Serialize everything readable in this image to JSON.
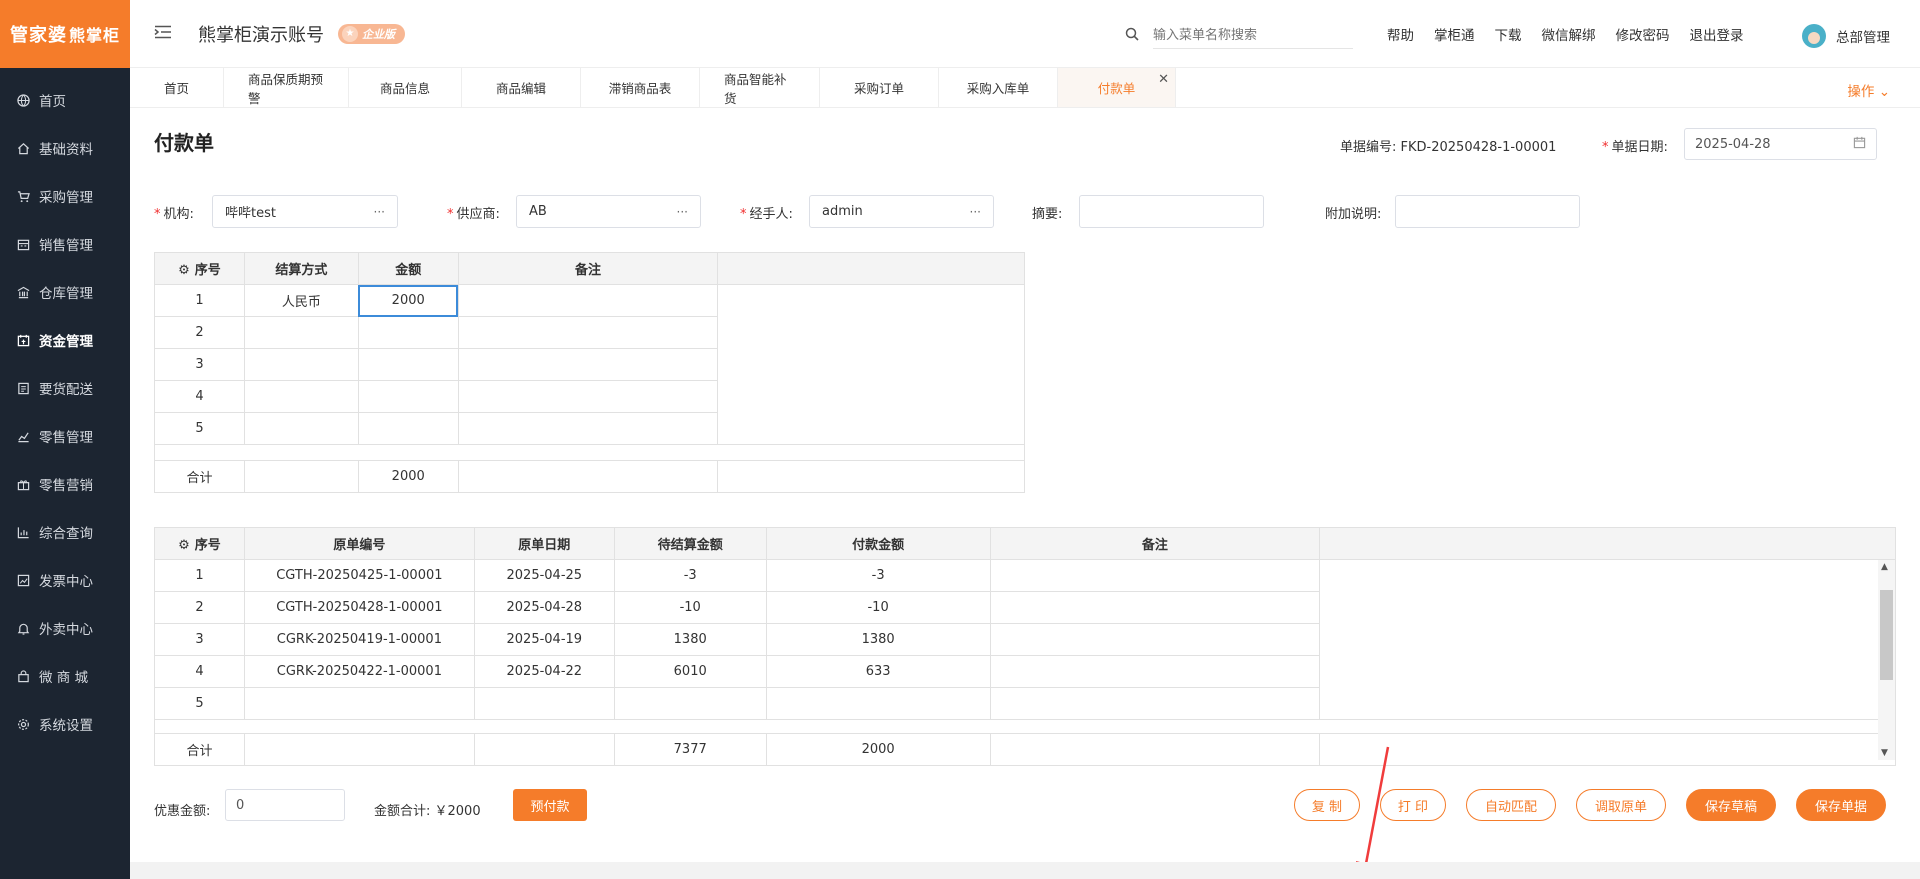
{
  "logo": {
    "main": "管家婆",
    "sub": "熊掌柜"
  },
  "sidebar": {
    "items": [
      {
        "label": "首页",
        "icon": "globe-icon"
      },
      {
        "label": "基础资料",
        "icon": "home-icon"
      },
      {
        "label": "采购管理",
        "icon": "cart-icon"
      },
      {
        "label": "销售管理",
        "icon": "calendar-icon"
      },
      {
        "label": "仓库管理",
        "icon": "bank-icon"
      },
      {
        "label": "资金管理",
        "icon": "calendar-check-icon"
      },
      {
        "label": "要货配送",
        "icon": "list-icon"
      },
      {
        "label": "零售管理",
        "icon": "chart-icon"
      },
      {
        "label": "零售营销",
        "icon": "gift-icon"
      },
      {
        "label": "综合查询",
        "icon": "bar-chart-icon"
      },
      {
        "label": "发票中心",
        "icon": "trend-icon"
      },
      {
        "label": "外卖中心",
        "icon": "bell-icon"
      },
      {
        "label": "微 商 城",
        "icon": "bag-icon"
      },
      {
        "label": "系统设置",
        "icon": "gear-icon"
      }
    ]
  },
  "header": {
    "account": "熊掌柜演示账号",
    "badge": "企业版",
    "search_placeholder": "输入菜单名称搜索",
    "links": [
      "帮助",
      "掌柜通",
      "下载",
      "微信解绑",
      "修改密码",
      "退出登录"
    ],
    "user": "总部管理"
  },
  "tabs": {
    "items": [
      "首页",
      "商品保质期预警",
      "商品信息",
      "商品编辑",
      "滞销商品表",
      "商品智能补货",
      "采购订单",
      "采购入库单",
      "付款单"
    ],
    "ops": "操作"
  },
  "page": {
    "title": "付款单",
    "doc_no_label": "单据编号:",
    "doc_no": "FKD-20250428-1-00001",
    "doc_date_label": "单据日期:",
    "doc_date": "2025-04-28"
  },
  "form": {
    "org_label": "机构:",
    "org_value": "哔哔test",
    "supplier_label": "供应商:",
    "supplier_value": "AB",
    "handler_label": "经手人:",
    "handler_value": "admin",
    "summary_label": "摘要:",
    "summary_value": "",
    "note_label": "附加说明:",
    "note_value": ""
  },
  "settle_table": {
    "headers": [
      "序号",
      "结算方式",
      "金额",
      "备注"
    ],
    "rows": [
      {
        "no": "1",
        "method": "人民币",
        "amount": "2000",
        "remark": ""
      },
      {
        "no": "2",
        "method": "",
        "amount": "",
        "remark": ""
      },
      {
        "no": "3",
        "method": "",
        "amount": "",
        "remark": ""
      },
      {
        "no": "4",
        "method": "",
        "amount": "",
        "remark": ""
      },
      {
        "no": "5",
        "method": "",
        "amount": "",
        "remark": ""
      }
    ],
    "total_label": "合计",
    "total_amount": "2000"
  },
  "orig_table": {
    "headers": [
      "序号",
      "原单编号",
      "原单日期",
      "待结算金额",
      "付款金额",
      "备注"
    ],
    "rows": [
      {
        "no": "1",
        "code": "CGTH-20250425-1-00001",
        "date": "2025-04-25",
        "pending": "-3",
        "pay": "-3",
        "remark": ""
      },
      {
        "no": "2",
        "code": "CGTH-20250428-1-00001",
        "date": "2025-04-28",
        "pending": "-10",
        "pay": "-10",
        "remark": ""
      },
      {
        "no": "3",
        "code": "CGRK-20250419-1-00001",
        "date": "2025-04-19",
        "pending": "1380",
        "pay": "1380",
        "remark": ""
      },
      {
        "no": "4",
        "code": "CGRK-20250422-1-00001",
        "date": "2025-04-22",
        "pending": "6010",
        "pay": "633",
        "remark": ""
      },
      {
        "no": "5",
        "code": "",
        "date": "",
        "pending": "",
        "pay": "",
        "remark": ""
      }
    ],
    "total_label": "合计",
    "total_pending": "7377",
    "total_pay": "2000"
  },
  "footer": {
    "discount_label": "优惠金额:",
    "discount_value": "0",
    "sum_label": "金额合计: ￥2000",
    "prepay_button": "预付款",
    "buttons": [
      "复 制",
      "打 印",
      "自动匹配",
      "调取原单",
      "保存草稿",
      "保存单据"
    ]
  },
  "colors": {
    "accent": "#f57c2a",
    "sidebar_bg": "#1c2531",
    "annotation_arrow": "#f03c3c"
  }
}
